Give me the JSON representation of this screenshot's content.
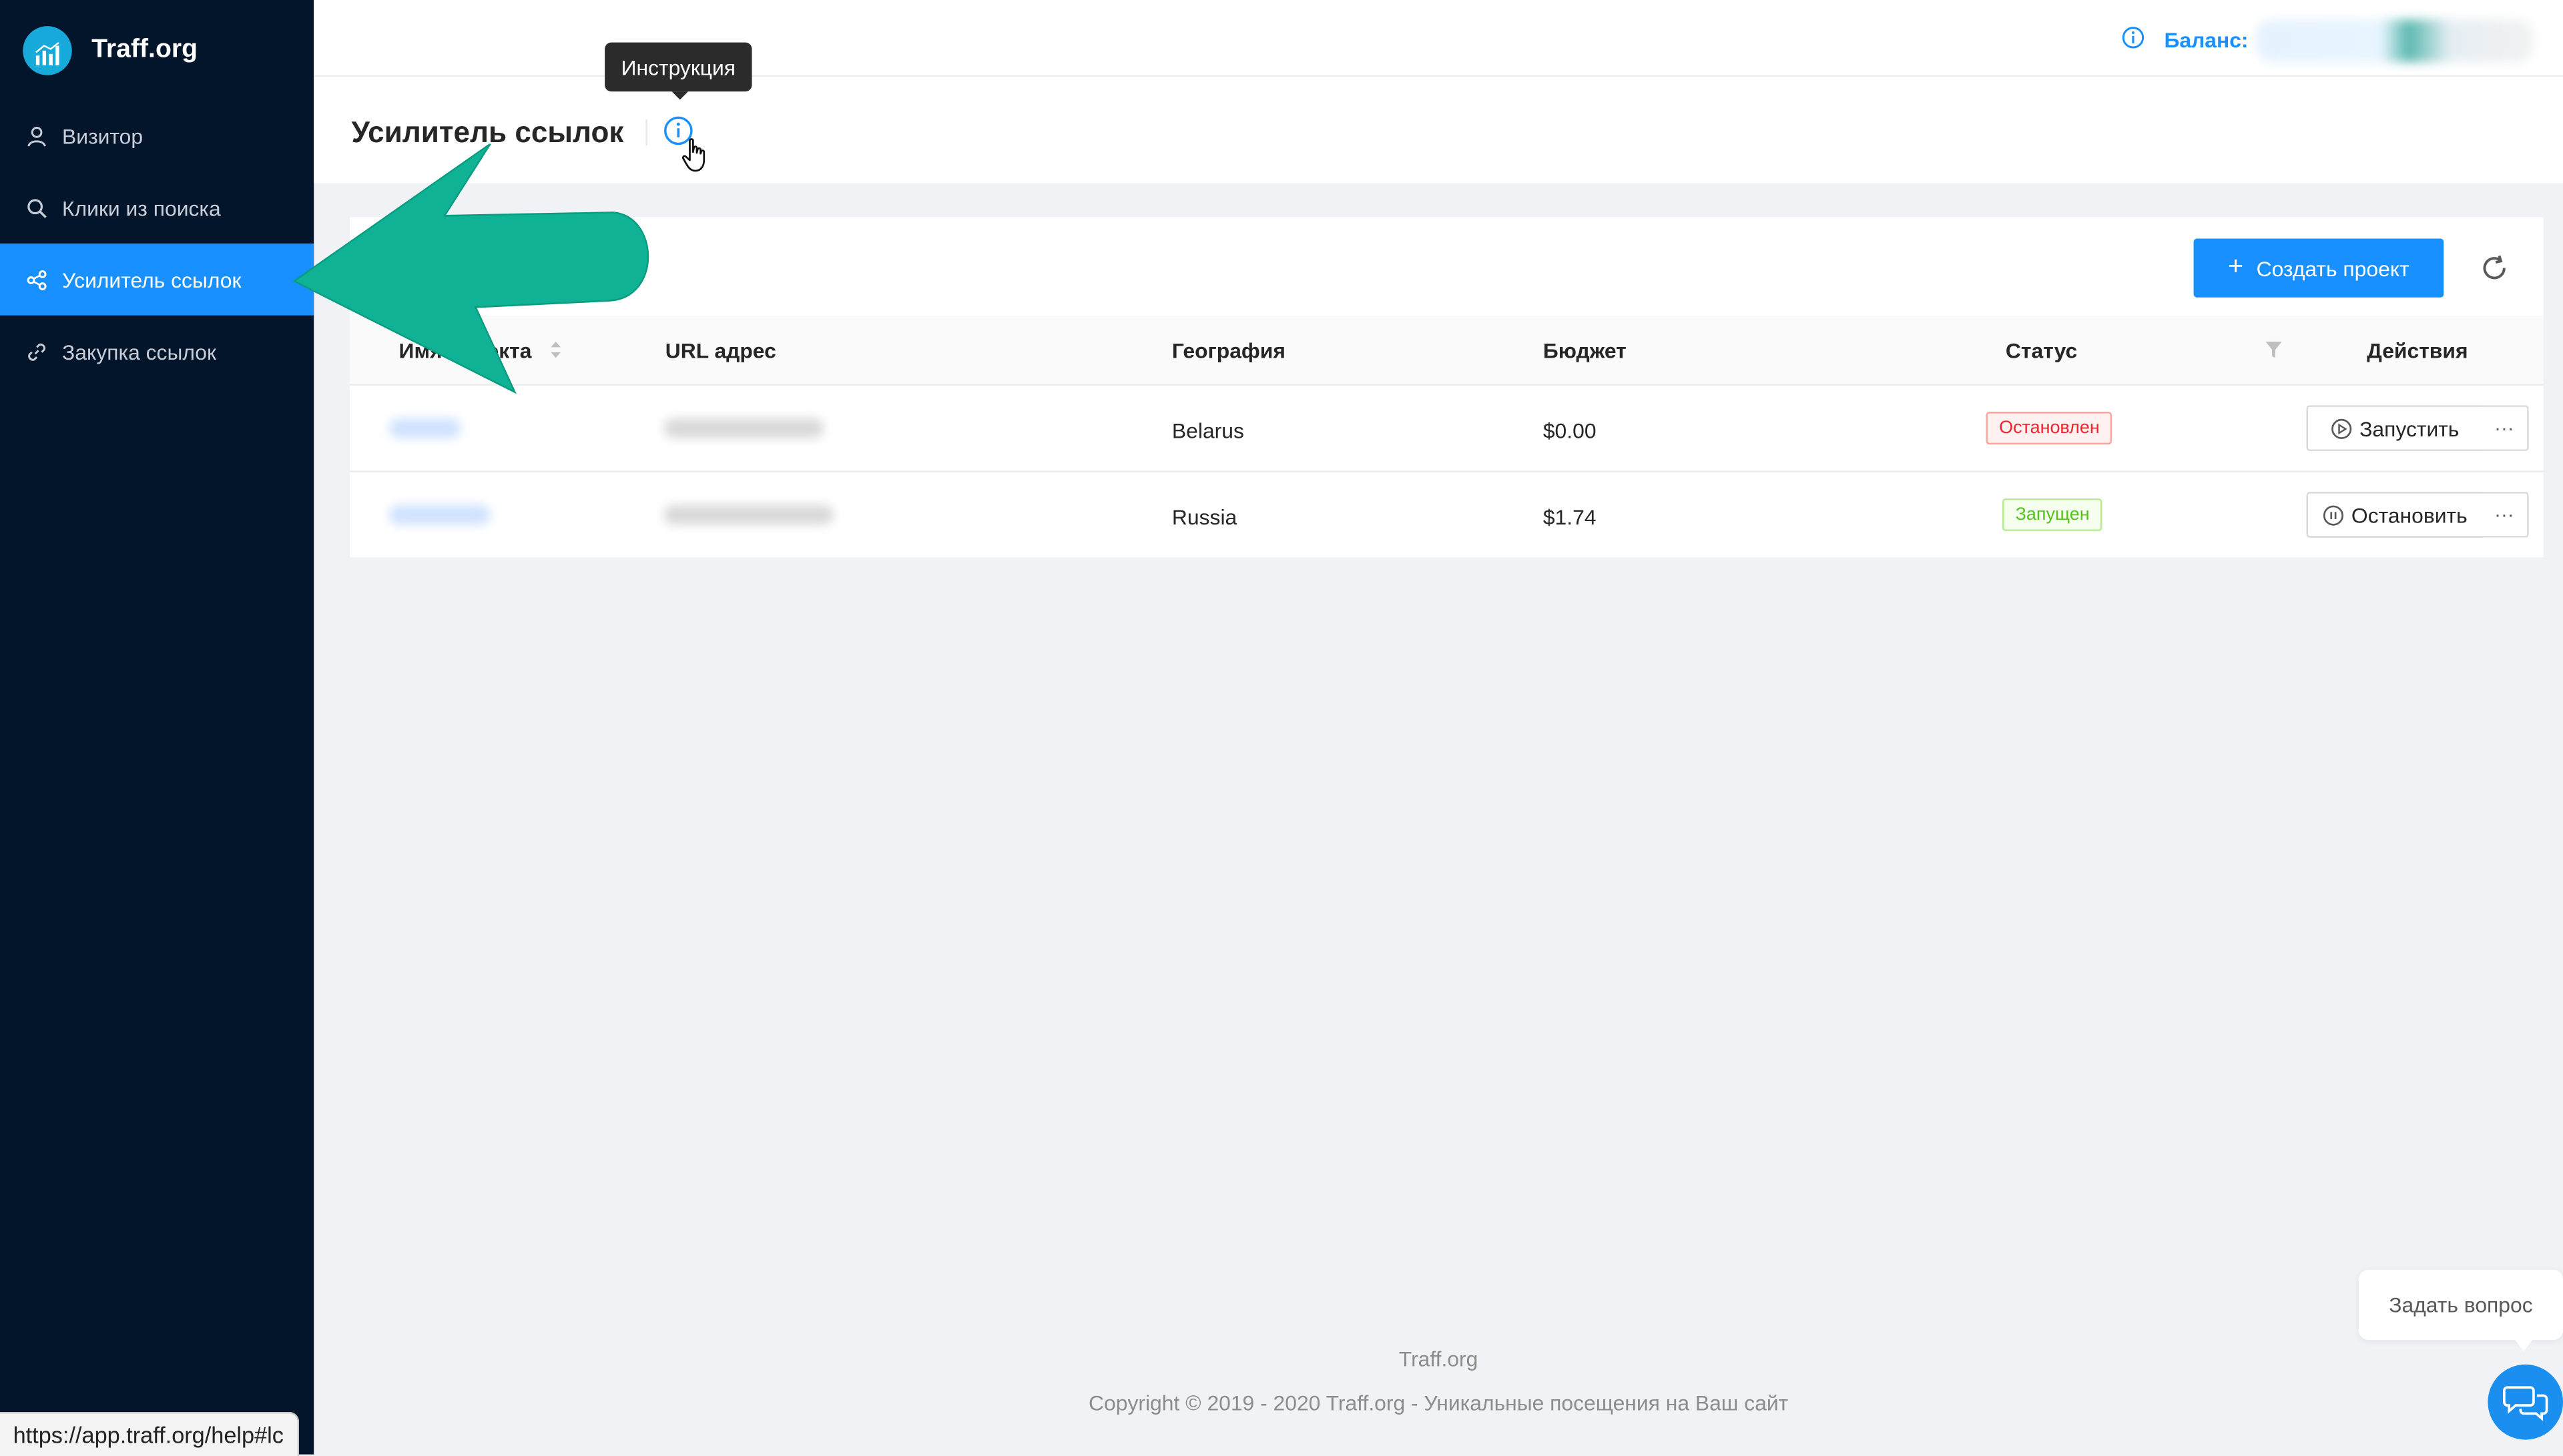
{
  "app": {
    "title": "Traff.org"
  },
  "sidebar": {
    "items": [
      {
        "label": "Визитор",
        "icon": "user-icon"
      },
      {
        "label": "Клики из поиска",
        "icon": "search-icon"
      },
      {
        "label": "Усилитель ссылок",
        "icon": "share-icon",
        "active": true
      },
      {
        "label": "Закупка ссылок",
        "icon": "link-icon"
      }
    ]
  },
  "header": {
    "balance_label": "Баланс:"
  },
  "page": {
    "title": "Усилитель ссылок",
    "tooltip": "Инструкция"
  },
  "toolbar": {
    "create_label": "Создать проект"
  },
  "table": {
    "columns": [
      "Имя проекта",
      "URL адрес",
      "География",
      "Бюджет",
      "Статус",
      "Действия"
    ],
    "rows": [
      {
        "geo": "Belarus",
        "budget": "$0.00",
        "status": "Остановлен",
        "action": "Запустить"
      },
      {
        "geo": "Russia",
        "budget": "$1.74",
        "status": "Запущен",
        "action": "Остановить"
      }
    ],
    "more_label": "···"
  },
  "footer": {
    "brand": "Traff.org",
    "copyright": "Copyright © 2019 - 2020 Traff.org - Уникальные посещения на Ваш сайт"
  },
  "chat": {
    "label": "Задать вопрос"
  },
  "statusbar": {
    "url": "https://app.traff.org/help#lc"
  },
  "colors": {
    "primary": "#1890ff",
    "sidebar": "#03152a",
    "arrow": "#0fb294",
    "danger": "#f5222d",
    "success": "#52c41a"
  }
}
